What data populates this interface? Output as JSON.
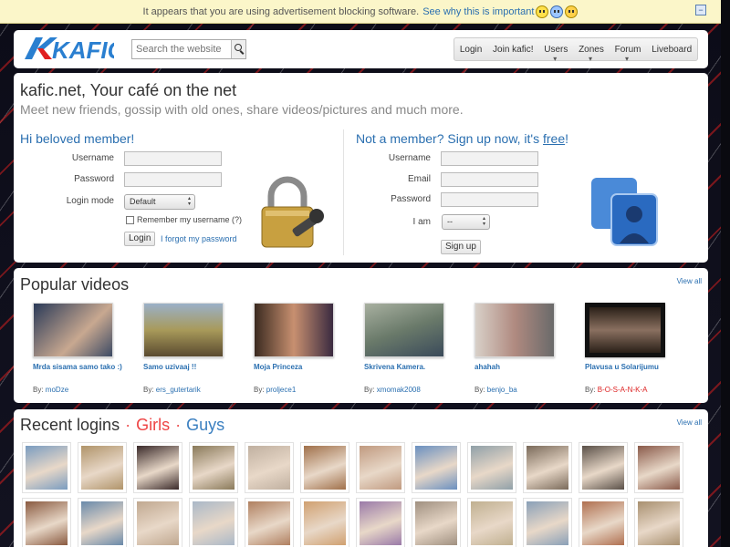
{
  "adbar": {
    "message": "It appears that you are using advertisement blocking software.",
    "link": "See why this is important",
    "close": "−"
  },
  "header": {
    "logo_text": "KAFIC",
    "search_placeholder": "Search the website",
    "nav": [
      "Login",
      "Join kafic!",
      "Users",
      "Zones",
      "Forum",
      "Liveboard"
    ]
  },
  "intro": {
    "title": "kafic.net, Your café on the net",
    "subtitle": "Meet new friends, gossip with old ones, share videos/pictures and much more."
  },
  "login": {
    "heading": "Hi beloved member!",
    "username_label": "Username",
    "password_label": "Password",
    "mode_label": "Login mode",
    "mode_value": "Default",
    "remember_label": "Remember my username (?)",
    "submit": "Login",
    "forgot": "I forgot my password"
  },
  "signup": {
    "heading_prefix": "Not a member? Sign up now, it's ",
    "heading_free": "free",
    "heading_suffix": "!",
    "username_label": "Username",
    "email_label": "Email",
    "password_label": "Password",
    "iam_label": "I am",
    "iam_value": "--",
    "submit": "Sign up"
  },
  "videos": {
    "title": "Popular videos",
    "view_all": "View all",
    "by": "By:",
    "items": [
      {
        "title": "Mrda sisama samo tako :)",
        "author": "moDze",
        "color": "#3c4a64"
      },
      {
        "title": "Samo uzivaaj !!",
        "author": "ers_gutertarik",
        "color": "#a89a5a"
      },
      {
        "title": "Moja Princeza",
        "author": "proljece1",
        "color": "#6a4a3a"
      },
      {
        "title": "Skrivena Kamera.",
        "author": "xmomak2008",
        "color": "#7a8a7a"
      },
      {
        "title": "ahahah",
        "author": "benjo_ba",
        "color": "#9a8a80"
      },
      {
        "title": "Plavusa u Solarijumu",
        "author": "B-O-S-A-N-K-A",
        "color": "#5a4a3a"
      }
    ]
  },
  "logins": {
    "title": "Recent logins",
    "dot": "·",
    "girls": "Girls",
    "guys": "Guys",
    "view_all": "View all",
    "row1": [
      "#7a9cc0",
      "#b0946a",
      "#3a2a2a",
      "#8a7a5a",
      "#c0b0a0",
      "#a0704a",
      "#c09a80",
      "#6a90c0",
      "#90a0a8",
      "#7a6a5a",
      "#5a5048",
      "#8a5a4a"
    ],
    "row2": [
      "#8a5a40",
      "#6a8aaa",
      "#c0a890",
      "#aab8c8",
      "#b08060",
      "#d0a070",
      "#9a7aa8",
      "#a09080",
      "#c0b090",
      "#8aa0b8",
      "#b07050",
      "#a89070"
    ]
  }
}
